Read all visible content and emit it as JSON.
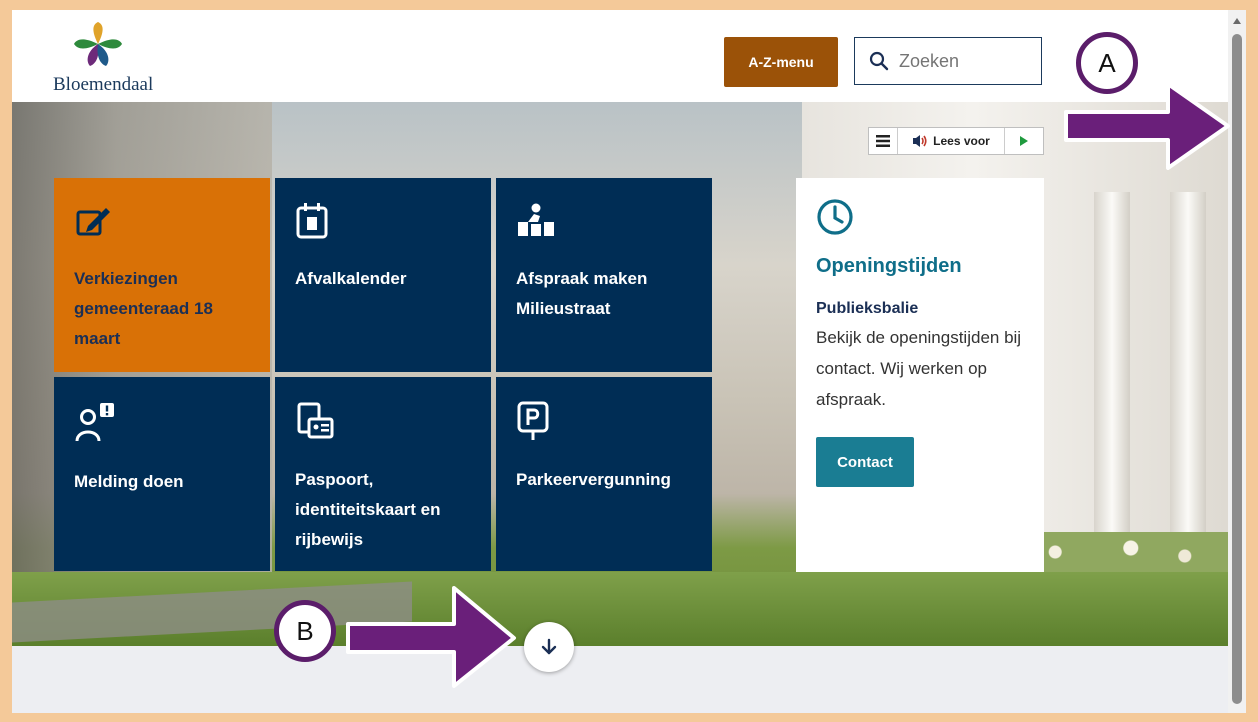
{
  "site": {
    "logo_text": "Bloemendaal"
  },
  "header": {
    "az_menu_label": "A-Z-menu",
    "search_placeholder": "Zoeken"
  },
  "readspeaker": {
    "label": "Lees voor"
  },
  "tiles": [
    {
      "label": "Verkiezingen gemeenteraad 18 maart",
      "icon": "ballot-edit-icon",
      "color": "#d97106"
    },
    {
      "label": "Afvalkalender",
      "icon": "calendar-bin-icon",
      "color": "#002d55"
    },
    {
      "label": "Afspraak maken Milieustraat",
      "icon": "person-containers-icon",
      "color": "#002d55"
    },
    {
      "label": "Melding doen",
      "icon": "person-alert-icon",
      "color": "#002d55"
    },
    {
      "label": "Paspoort, identiteitskaart en rijbewijs",
      "icon": "id-documents-icon",
      "color": "#002d55"
    },
    {
      "label": "Parkeervergunning",
      "icon": "parking-sign-icon",
      "color": "#002d55"
    }
  ],
  "info_card": {
    "icon": "clock-icon",
    "title": "Openingstijden",
    "subtitle": "Publieksbalie",
    "text": "Bekijk de openingstijden bij contact. Wij werken op afspraak.",
    "button": "Contact"
  },
  "annotations": {
    "callout_a": "A",
    "callout_b": "B",
    "arrow_color": "#6a1f7a"
  },
  "colors": {
    "navy": "#002d55",
    "orange": "#d97106",
    "brown": "#9b5208",
    "teal": "#1a7d93",
    "frame": "#f4c999"
  }
}
